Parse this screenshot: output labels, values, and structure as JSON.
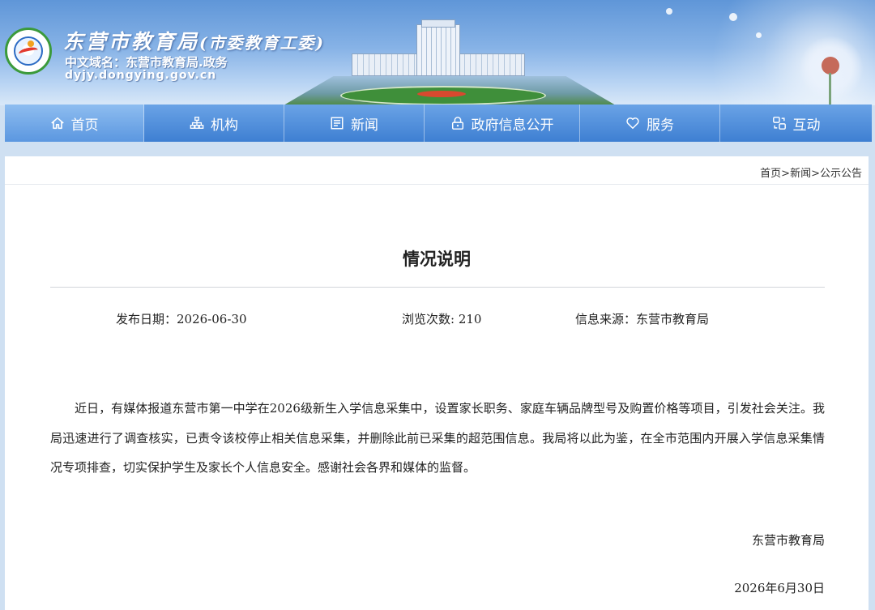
{
  "header": {
    "title": "东营市教育局",
    "title_paren": "(市委教育工委)",
    "domain_cn": "中文域名：东营市教育局.政务",
    "domain_en": "dyjy.dongying.gov.cn"
  },
  "nav": {
    "items": [
      {
        "label": "首页",
        "icon": "home-icon",
        "active": true
      },
      {
        "label": "机构",
        "icon": "org-chart-icon",
        "active": false
      },
      {
        "label": "新闻",
        "icon": "newspaper-icon",
        "active": false
      },
      {
        "label": "政府信息公开",
        "icon": "lock-icon",
        "active": false
      },
      {
        "label": "服务",
        "icon": "heart-icon",
        "active": false
      },
      {
        "label": "互动",
        "icon": "interact-icon",
        "active": false
      }
    ]
  },
  "breadcrumb": {
    "items": [
      "首页",
      "新闻",
      "公示公告"
    ],
    "separator": ">"
  },
  "article": {
    "title": "情况说明",
    "publish_date": "发布日期：2026-06-30",
    "views": "浏览次数: 210",
    "source": "信息来源：东营市教育局",
    "body": "近日，有媒体报道东营市第一中学在2026级新生入学信息采集中，设置家长职务、家庭车辆品牌型号及购置价格等项目，引发社会关注。我局迅速进行了调查核实，已责令该校停止相关信息采集，并删除此前已采集的超范围信息。我局将以此为鉴，在全市范围内开展入学信息采集情况专项排查，切实保护学生及家长个人信息安全。感谢社会各界和媒体的监督。",
    "signature_org": "东营市教育局",
    "signature_date": "2026年6月30日"
  },
  "colors": {
    "nav_bg": "#3e7fd2",
    "nav_active": "#5b97e0",
    "banner_top": "#5f96d8",
    "page_bg": "#cfe0f2"
  }
}
